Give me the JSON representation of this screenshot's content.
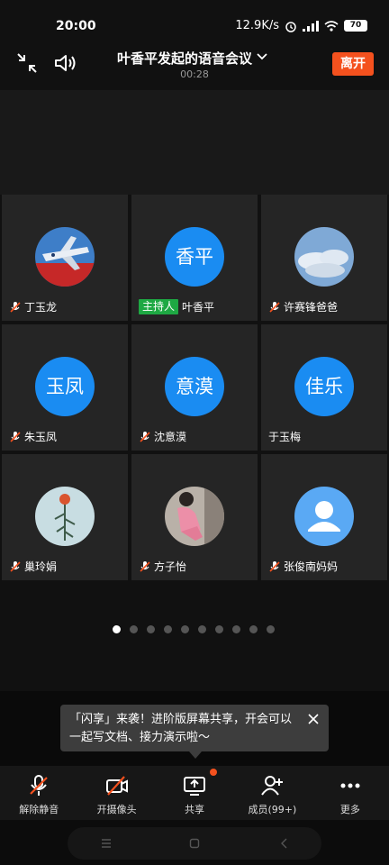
{
  "status": {
    "time": "20:00",
    "speed": "12.9K/s",
    "battery": "70"
  },
  "header": {
    "title": "叶香平发起的语音会议",
    "duration": "00:28",
    "leave_label": "离开"
  },
  "participants": [
    {
      "name": "丁玉龙",
      "avatar_type": "photo",
      "avatar_desc": "airplane",
      "muted": true,
      "host": false
    },
    {
      "name": "叶香平",
      "avatar_type": "text",
      "avatar_text": "香平",
      "muted": false,
      "host": true,
      "host_label": "主持人"
    },
    {
      "name": "许赛锋爸爸",
      "avatar_type": "photo",
      "avatar_desc": "sky",
      "muted": true,
      "host": false
    },
    {
      "name": "朱玉凤",
      "avatar_type": "text",
      "avatar_text": "玉凤",
      "muted": true,
      "host": false
    },
    {
      "name": "沈意漠",
      "avatar_type": "text",
      "avatar_text": "意漠",
      "muted": true,
      "host": false
    },
    {
      "name": "于玉梅",
      "avatar_type": "text",
      "avatar_text": "佳乐",
      "muted": false,
      "host": false
    },
    {
      "name": "巢玲娟",
      "avatar_type": "photo",
      "avatar_desc": "flower",
      "muted": true,
      "host": false
    },
    {
      "name": "方子怡",
      "avatar_type": "photo",
      "avatar_desc": "person",
      "muted": true,
      "host": false
    },
    {
      "name": "张俊南妈妈",
      "avatar_type": "default",
      "avatar_desc": "person-icon",
      "muted": true,
      "host": false
    }
  ],
  "pager": {
    "count": 10,
    "active_index": 0
  },
  "toast": {
    "text": "「闪享」来袭！进阶版屏幕共享，开会可以一起写文档、接力演示啦～"
  },
  "toolbar": {
    "unmute_label": "解除静音",
    "camera_label": "开摄像头",
    "share_label": "共享",
    "members_label": "成员(99+)",
    "more_label": "更多"
  },
  "colors": {
    "accent_blue": "#1a8cf2",
    "leave_red": "#f4511e",
    "host_green": "#1ea843"
  }
}
